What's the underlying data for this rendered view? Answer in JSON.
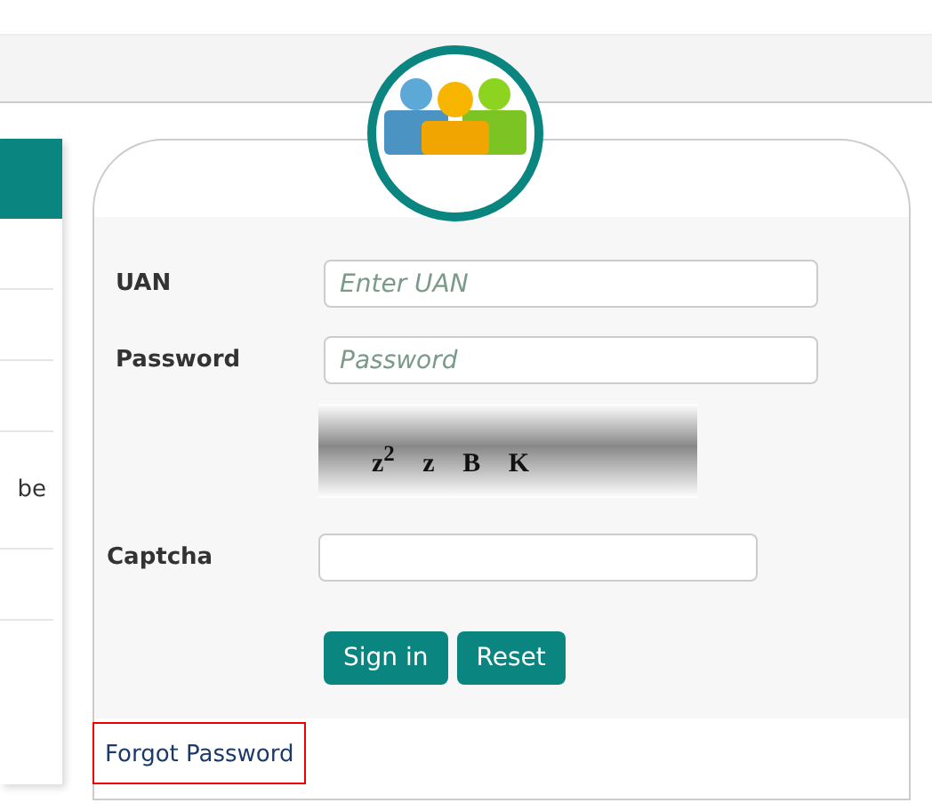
{
  "side_panel": {
    "text": "be"
  },
  "login": {
    "fields": [
      {
        "label": "UAN",
        "placeholder": "Enter UAN"
      },
      {
        "label": "Password",
        "placeholder": "Password"
      }
    ],
    "captcha": {
      "image_text": "z$^{2}$ z B K",
      "label": "Captcha"
    },
    "buttons": [
      "Sign in",
      "Reset"
    ],
    "forgot_link": "Forgot Password"
  }
}
